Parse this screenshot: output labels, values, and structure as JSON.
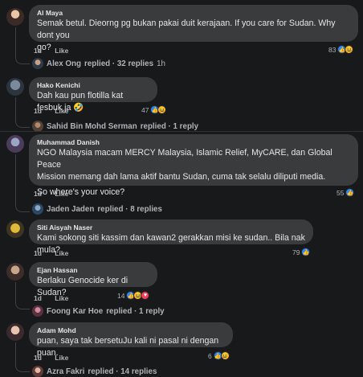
{
  "colors": {
    "background": "#18191a",
    "bubble": "#3a3b3c",
    "muted": "#b0b3b8",
    "like": "#2d88ff",
    "haha": "#f7b928"
  },
  "comments": [
    {
      "author": "Al Maya",
      "lines": [
        "Semak betul. Dieorng pg bukan pakai duit kerajaan. If you care for Sudan. Why dont you",
        "go?"
      ],
      "time": "1d",
      "like": "Like",
      "reaction_count": "83",
      "reactions": [
        "like-icon",
        "haha-icon"
      ],
      "replier": "Alex Ong",
      "replies": "replied · 32 replies",
      "reply_time": "1h"
    },
    {
      "author": "Hako Kenichi",
      "lines": [
        "Dah kau pun flotilla kat fesbuk ja 🤣"
      ],
      "time": "1d",
      "like": "Like",
      "reaction_count": "47",
      "reactions": [
        "like-icon",
        "haha-icon"
      ],
      "replier": "Sahid Bin Mohd Serman",
      "replies": "replied · 1 reply",
      "reply_time": ""
    },
    {
      "author": "Muhammad Danish",
      "lines": [
        "NGO Malaysia macam MERCY Malaysia, Islamic Relief, MyCARE, dan Global Peace",
        "Mission memang dah lama aktif bantu Sudan, cuma tak selalu diliputi media.",
        "",
        "So where's your voice?"
      ],
      "time": "1d",
      "like": "Like",
      "reaction_count": "55",
      "reactions": [
        "like-icon"
      ],
      "replier": "Jaden Jaden",
      "replies": "replied · 8 replies",
      "reply_time": ""
    },
    {
      "author": "Siti Aisyah Naser",
      "lines": [
        "Kami sokong siti kassim dan kawan2 gerakkan misi ke sudan.. Bila nak mula?"
      ],
      "time": "1d",
      "like": "Like",
      "reaction_count": "79",
      "reactions": [
        "like-icon"
      ],
      "replier": "",
      "replies": "",
      "reply_time": ""
    },
    {
      "author": "Ejan Hassan",
      "lines": [
        "Berlaku Genocide ker di Sudan?"
      ],
      "time": "1d",
      "like": "Like",
      "reaction_count": "14",
      "reactions": [
        "like-icon",
        "haha-icon",
        "love-icon"
      ],
      "replier": "Foong Kar Hoe",
      "replies": "replied · 1 reply",
      "reply_time": ""
    },
    {
      "author": "Adam Mohd",
      "lines": [
        "puan, saya tak bersetuJu kali ni pasal ni dengan puan."
      ],
      "time": "1d",
      "like": "Like",
      "reaction_count": "6",
      "reactions": [
        "like-icon",
        "haha-icon"
      ],
      "replier": "Azra Fakri",
      "replies": "replied · 14 replies",
      "reply_time": ""
    }
  ]
}
